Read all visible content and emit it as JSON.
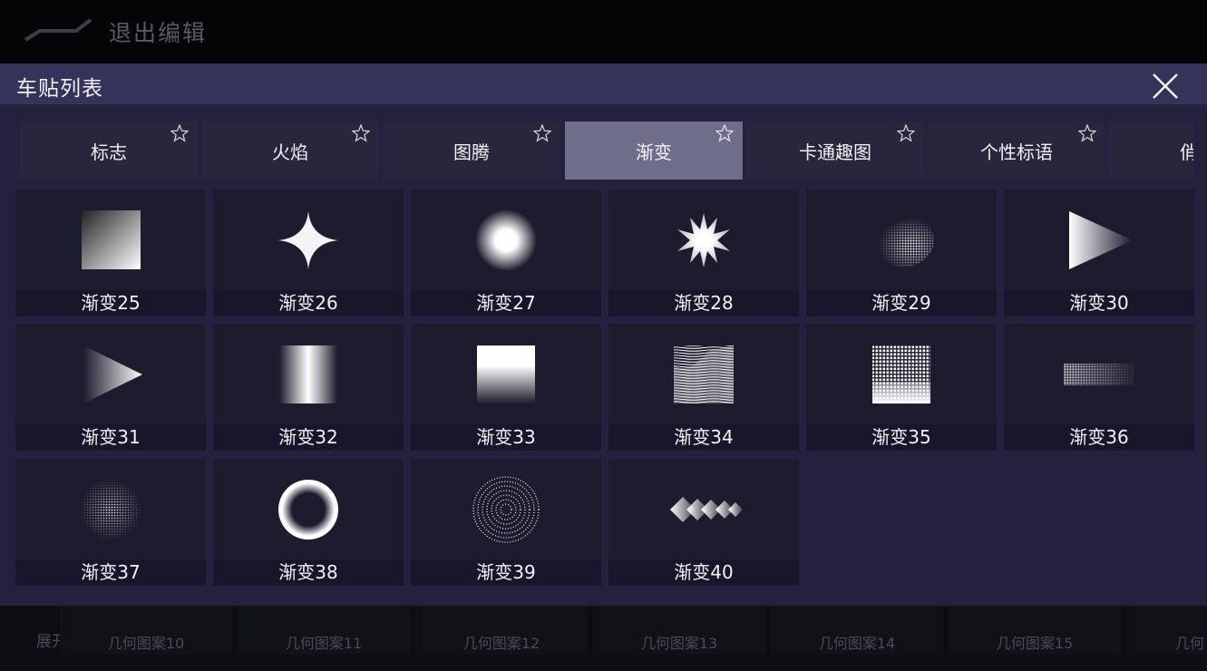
{
  "topbar": {
    "exit_label": "退出编辑"
  },
  "background": {
    "expand_label": "展开",
    "items": [
      "几何图案10",
      "几何图案11",
      "几何图案12",
      "几何图案13",
      "几何图案14",
      "几何图案15",
      "几何"
    ]
  },
  "panel": {
    "title": "车贴列表",
    "close_icon": "close-icon",
    "tabs": [
      {
        "label": "标志",
        "active": false
      },
      {
        "label": "火焰",
        "active": false
      },
      {
        "label": "图腾",
        "active": false
      },
      {
        "label": "渐变",
        "active": true
      },
      {
        "label": "卡通趣图",
        "active": false
      },
      {
        "label": "个性标语",
        "active": false
      },
      {
        "label": "俏皮",
        "active": false
      }
    ],
    "stickers": [
      {
        "label": "渐变25",
        "icon": "gradient-square-icon"
      },
      {
        "label": "渐变26",
        "icon": "four-point-star-icon"
      },
      {
        "label": "渐变27",
        "icon": "glow-dot-icon"
      },
      {
        "label": "渐变28",
        "icon": "starburst-icon"
      },
      {
        "label": "渐变29",
        "icon": "halftone-sphere-icon"
      },
      {
        "label": "渐变30",
        "icon": "gradient-triangle-icon"
      },
      {
        "label": "渐变31",
        "icon": "gradient-triangle-icon"
      },
      {
        "label": "渐变32",
        "icon": "vertical-bar-gradient-icon"
      },
      {
        "label": "渐变33",
        "icon": "fade-down-square-icon"
      },
      {
        "label": "渐变34",
        "icon": "wave-lines-icon"
      },
      {
        "label": "渐变35",
        "icon": "halftone-square-icon"
      },
      {
        "label": "渐变36",
        "icon": "halftone-strip-icon"
      },
      {
        "label": "渐变37",
        "icon": "halftone-circle-icon"
      },
      {
        "label": "渐变38",
        "icon": "ring-icon"
      },
      {
        "label": "渐变39",
        "icon": "dotted-circle-icon"
      },
      {
        "label": "渐变40",
        "icon": "diamond-chain-icon"
      }
    ]
  },
  "colors": {
    "panel_bg": "#242240",
    "header_bg": "#343359",
    "active_tab": "#6f6e8a",
    "tile_bg": "#1d1c2e"
  }
}
